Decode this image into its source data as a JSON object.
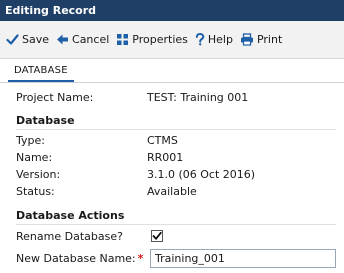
{
  "window": {
    "title": "Editing Record"
  },
  "toolbar": {
    "save": "Save",
    "cancel": "Cancel",
    "properties": "Properties",
    "help": "Help",
    "print": "Print"
  },
  "tabs": [
    {
      "label": "DATABASE",
      "active": true
    }
  ],
  "project": {
    "label": "Project Name:",
    "value": "TEST: Training 001"
  },
  "database": {
    "heading": "Database",
    "type_label": "Type:",
    "type_value": "CTMS",
    "name_label": "Name:",
    "name_value": "RR001",
    "version_label": "Version:",
    "version_value": "3.1.0 (06 Oct 2016)",
    "status_label": "Status:",
    "status_value": "Available"
  },
  "actions": {
    "heading": "Database Actions",
    "rename_label": "Rename Database?",
    "rename_checked": true,
    "new_name_label": "New Database Name:",
    "required_mark": "*",
    "new_name_value": "Training_001"
  },
  "colors": {
    "titlebar": "#1f3f66",
    "icon_blue": "#1f5fa8",
    "required": "#d21a1a"
  },
  "icons": {
    "save": "checkmark-icon",
    "cancel": "arrow-left-icon",
    "properties": "grid-icon",
    "help": "question-icon",
    "print": "printer-icon"
  }
}
